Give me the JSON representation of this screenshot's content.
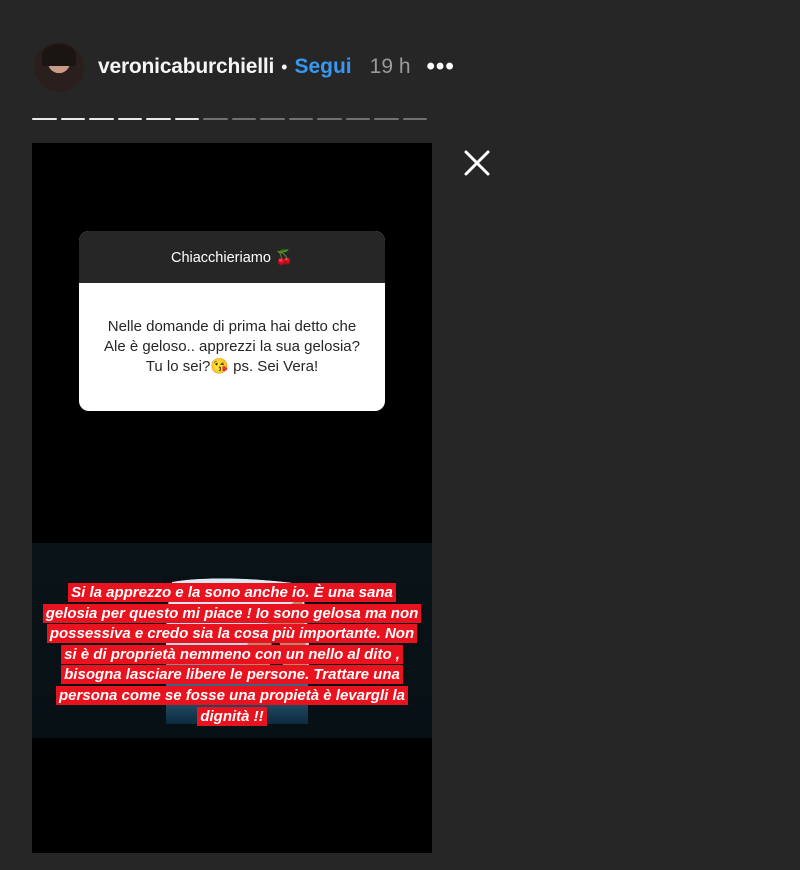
{
  "header": {
    "username": "veronicaburchielli",
    "separator": "•",
    "follow_label": "Segui",
    "time": "19 h",
    "more_label": "•••"
  },
  "story": {
    "progress": {
      "total": 14,
      "current": 6
    },
    "question_box": {
      "title": "Chiacchieriamo 🍒",
      "question": "Nelle domande di prima hai detto che Ale è geloso.. apprezzi la sua gelosia? Tu lo sei?😘 ps. Sei Vera!"
    },
    "answer_text": "Si la apprezzo e la sono anche io. È una sana gelosia per questo mi piace ! Io sono gelosa ma non possessiva e credo sia la cosa più importante. Non si è di proprietà nemmeno con un nello al dito , bisogna lasciare libere le persone. Trattare una persona come se fosse una propietà è levargli la dignità !!"
  },
  "colors": {
    "background": "#262626",
    "follow": "#3897f0",
    "highlight": "#e8131f"
  },
  "icons": [
    "close-icon",
    "more-icon"
  ]
}
